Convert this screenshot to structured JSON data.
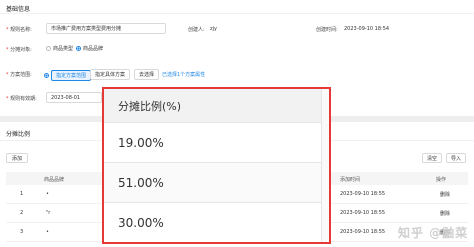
{
  "basic": {
    "section_title": "基础信息",
    "rule_name_label": "规则名称",
    "rule_name_value": "市场推广费用方案类型费用分摊",
    "creator_label": "创建人",
    "creator_value": "zjy",
    "created_time_label": "创建时间",
    "created_time_value": "2023-09-10 18:54",
    "rule_object_label": "分摊对象",
    "rule_object_options": [
      "商品类型",
      "商品品牌"
    ],
    "plan_scope_label": "方案范围",
    "plan_scope_option": "指定方案范围",
    "plan_scope_chips": [
      "指定具体方案",
      "去选择"
    ],
    "plan_scope_link": "已选择1个方案属性",
    "valid_period_label": "规则有效期",
    "valid_period_value": "2023-08-01"
  },
  "ratio_section": {
    "title": "分摊比例",
    "add_button": "添加",
    "clear_button": "清空",
    "import_button": "导入",
    "columns": [
      "商品品牌",
      "添加时间",
      "操作"
    ],
    "rows": [
      {
        "index": "1",
        "brand": "•",
        "time": "2023-09-10 18:55",
        "action": "删除"
      },
      {
        "index": "2",
        "brand": "\"r",
        "time": "2023-09-10 18:55",
        "action": "删除"
      },
      {
        "index": "3",
        "brand": "•",
        "time": "2023-09-10 18:55",
        "action": "删除"
      }
    ]
  },
  "overlay": {
    "header": "分摊比例(%)",
    "values": [
      "19.00%",
      "51.00%",
      "30.00%"
    ]
  },
  "watermark": "知乎 @鼬菜",
  "colors": {
    "accent": "#1e88e5",
    "highlight": "#e53935"
  }
}
